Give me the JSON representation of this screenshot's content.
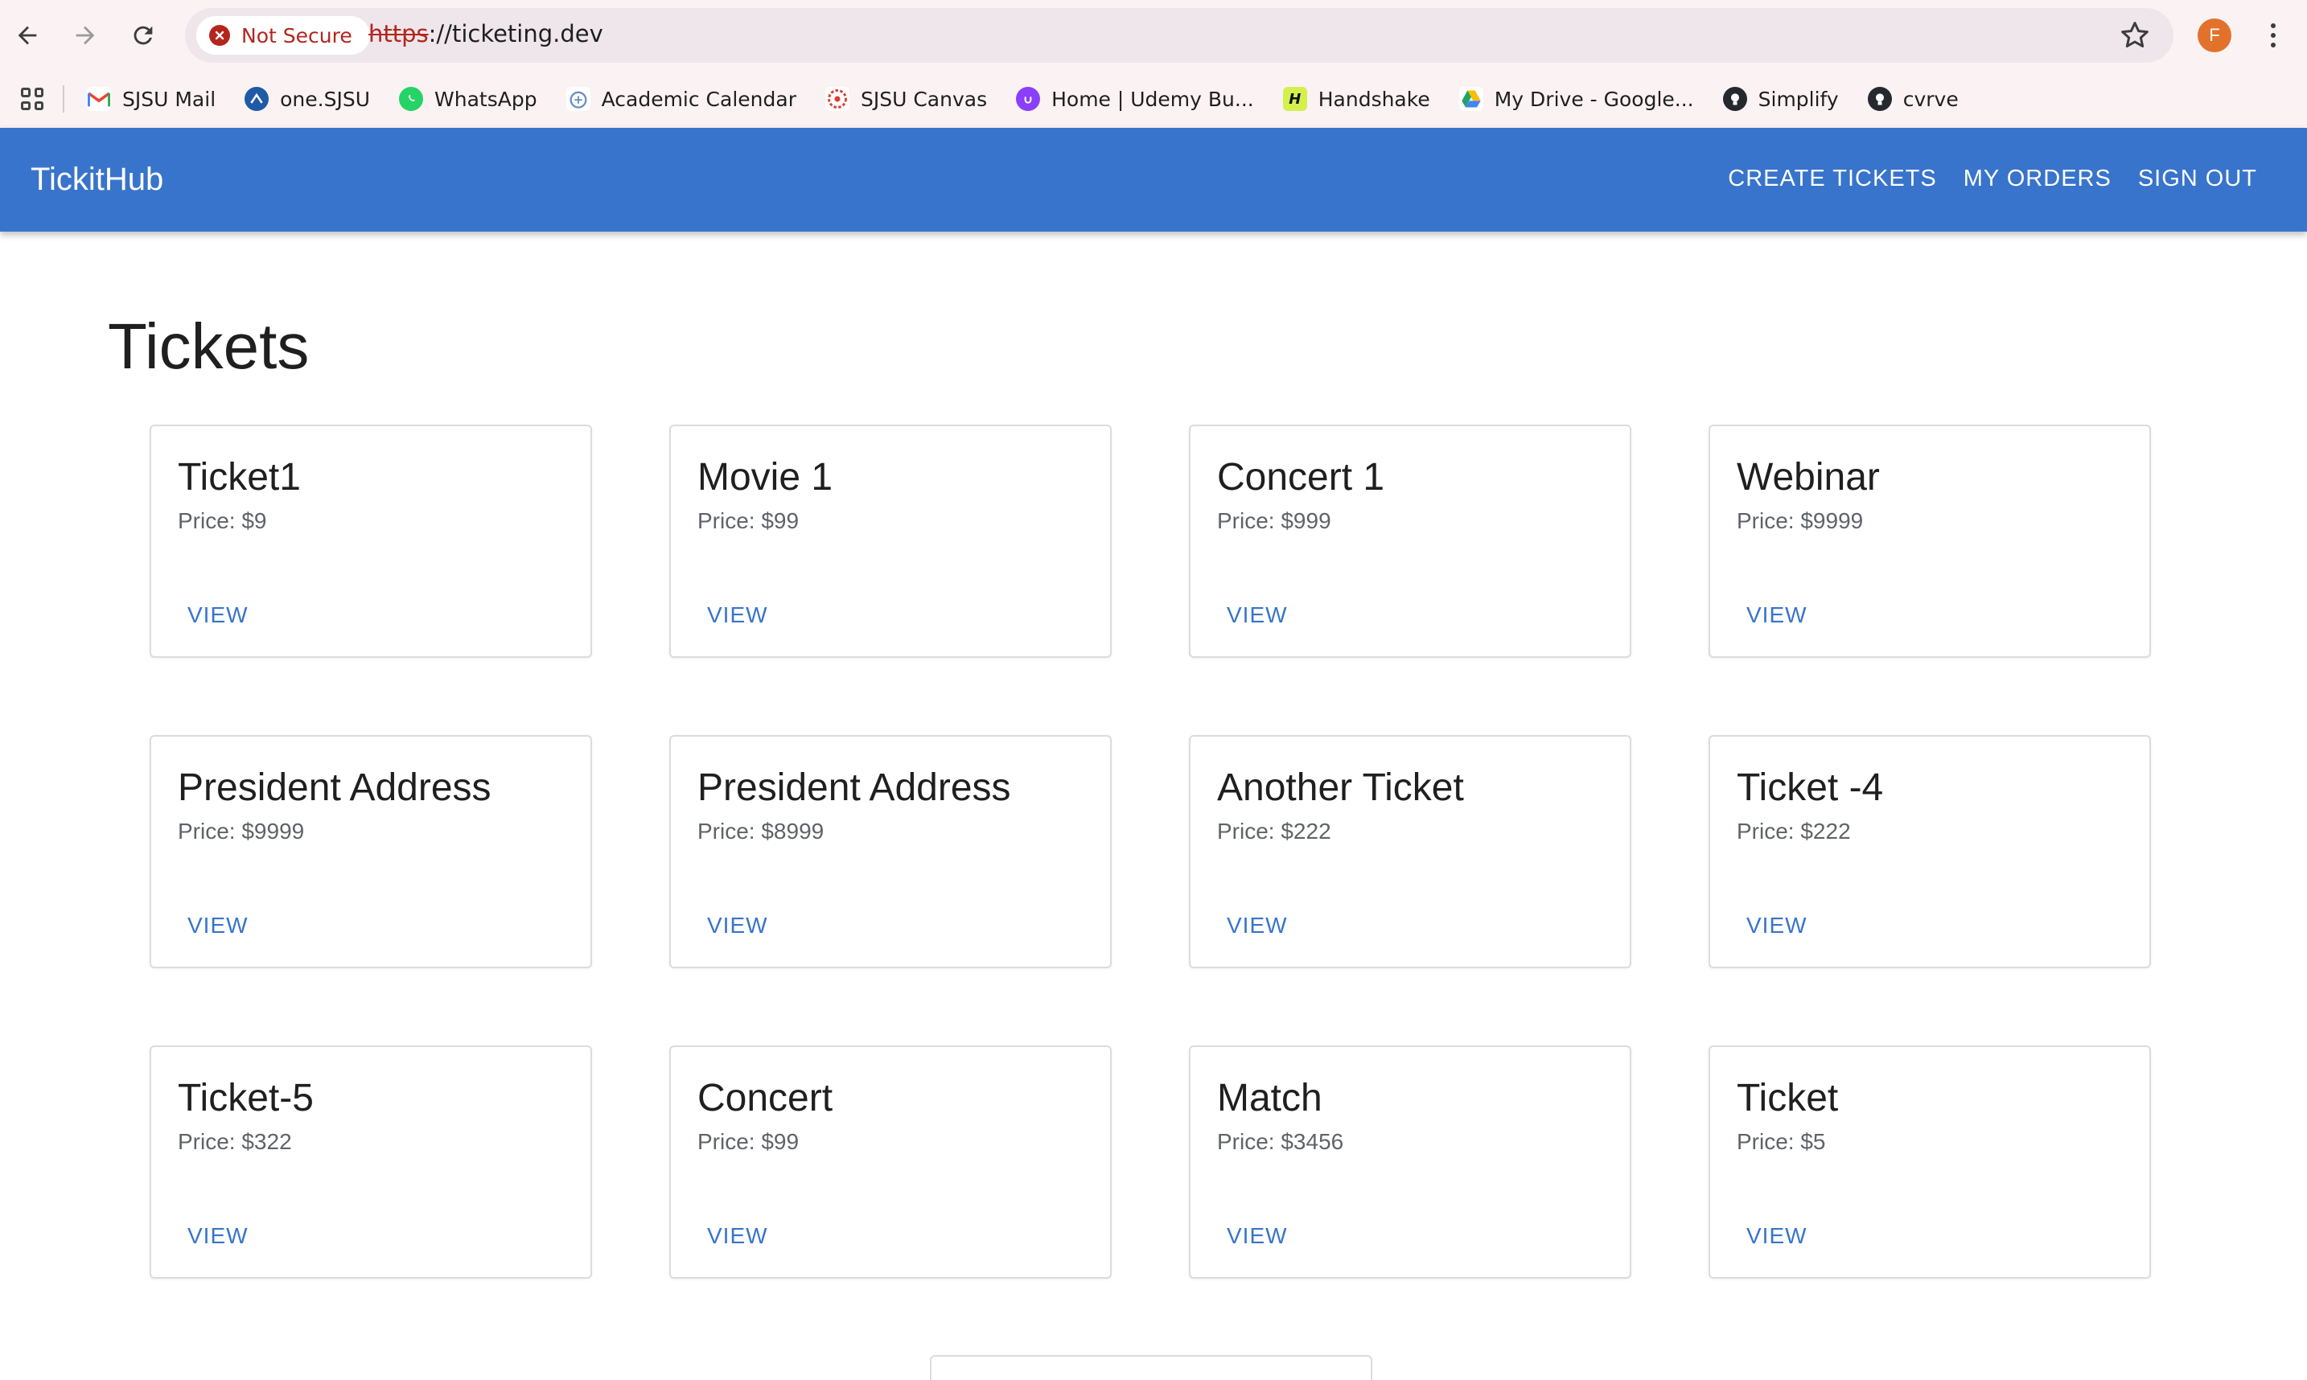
{
  "browser": {
    "security_label": "Not Secure",
    "url_scheme": "https",
    "url_rest": "://ticketing.dev",
    "profile_initial": "F",
    "bookmarks": [
      {
        "label": "SJSU Mail",
        "icon": "gmail-icon",
        "color": "#ea4335"
      },
      {
        "label": "one.SJSU",
        "icon": "one-sjsu-icon",
        "color": "#1f5aa6"
      },
      {
        "label": "WhatsApp",
        "icon": "whatsapp-icon",
        "color": "#25d366"
      },
      {
        "label": "Academic Calendar",
        "icon": "calendar-icon",
        "color": "#6a8fc4"
      },
      {
        "label": "SJSU Canvas",
        "icon": "canvas-icon",
        "color": "#e03c31"
      },
      {
        "label": "Home | Udemy Bu...",
        "icon": "udemy-icon",
        "color": "#8a3ffc"
      },
      {
        "label": "Handshake",
        "icon": "handshake-icon",
        "color": "#d4f04c"
      },
      {
        "label": "My Drive - Google...",
        "icon": "google-drive-icon",
        "color": "#1fa463"
      },
      {
        "label": "Simplify",
        "icon": "github-icon",
        "color": "#24292f"
      },
      {
        "label": "cvrve",
        "icon": "github-icon",
        "color": "#24292f"
      }
    ]
  },
  "app": {
    "brand": "TickitHub",
    "nav": {
      "create": "CREATE TICKETS",
      "orders": "MY ORDERS",
      "signout": "SIGN OUT"
    },
    "accent": "#3874cb"
  },
  "page": {
    "title": "Tickets",
    "tickets": [
      {
        "title": "Ticket1",
        "price": "Price: $9",
        "action": "VIEW"
      },
      {
        "title": "Movie 1",
        "price": "Price: $99",
        "action": "VIEW"
      },
      {
        "title": "Concert 1",
        "price": "Price: $999",
        "action": "VIEW"
      },
      {
        "title": "Webinar",
        "price": "Price: $9999",
        "action": "VIEW"
      },
      {
        "title": "President Address",
        "price": "Price: $9999",
        "action": "VIEW"
      },
      {
        "title": "President Address",
        "price": "Price: $8999",
        "action": "VIEW"
      },
      {
        "title": "Another Ticket",
        "price": "Price: $222",
        "action": "VIEW"
      },
      {
        "title": "Ticket -4",
        "price": "Price: $222",
        "action": "VIEW"
      },
      {
        "title": "Ticket-5",
        "price": "Price: $322",
        "action": "VIEW"
      },
      {
        "title": "Concert",
        "price": "Price: $99",
        "action": "VIEW"
      },
      {
        "title": "Match",
        "price": "Price: $3456",
        "action": "VIEW"
      },
      {
        "title": "Ticket",
        "price": "Price: $5",
        "action": "VIEW"
      }
    ]
  }
}
